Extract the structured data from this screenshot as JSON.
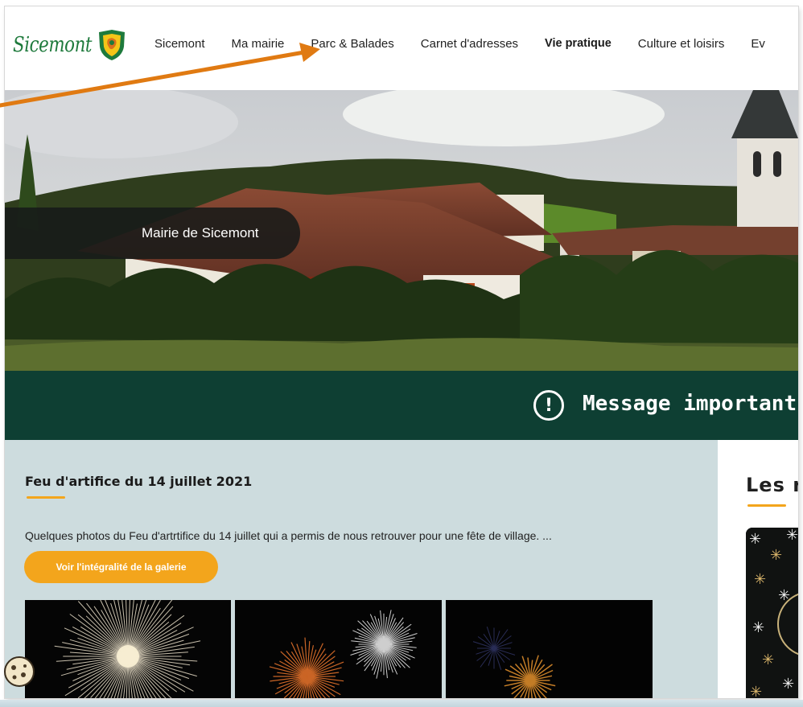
{
  "header": {
    "logo_text": "Sicemont",
    "nav": [
      {
        "label": "Sicemont"
      },
      {
        "label": "Ma mairie"
      },
      {
        "label": "Parc & Balades"
      },
      {
        "label": "Carnet d'adresses"
      },
      {
        "label": "Vie pratique"
      },
      {
        "label": "Culture et loisirs"
      },
      {
        "label": "Ev"
      }
    ]
  },
  "hero": {
    "label": "Mairie de Sicemont"
  },
  "alert": {
    "icon": "exclamation-circle-icon",
    "text": "Message important"
  },
  "article": {
    "title": "Feu d'artifice du 14 juillet 2021",
    "excerpt": "Quelques photos du Feu d'artrtifice du 14 juillet qui a permis de nous retrouver pour une fête de village. ...",
    "button_label": "Voir l'intégralité de la galerie"
  },
  "sidebar": {
    "title": "Les r"
  },
  "colors": {
    "brand_green": "#1e7a3c",
    "dark_band": "#0e3f33",
    "accent_orange": "#f3a51c",
    "content_bg": "#cddcde",
    "annotation_arrow": "#e07a12"
  }
}
